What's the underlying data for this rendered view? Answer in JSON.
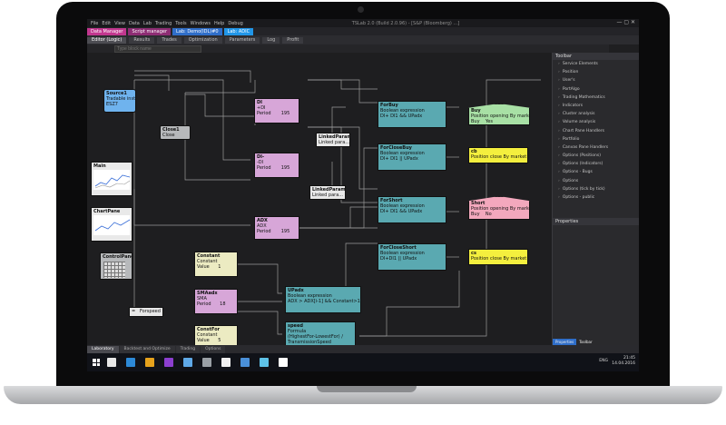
{
  "window": {
    "title": "TSLab 2.0 (Build 2.0.96) - [S&P (Bloomberg) ...]",
    "menu": [
      "File",
      "Edit",
      "View",
      "Data",
      "Lab",
      "Trading",
      "Tools",
      "Windows",
      "Help",
      "Debug"
    ]
  },
  "tabs": [
    "Data Manager",
    "Script manager",
    "Lab: Demo(IDL)#0",
    "Lab: ADIC"
  ],
  "toolbar": [
    "Editor (Logic)",
    "Results",
    "Trades",
    "Optimization",
    "Parameters",
    "Log",
    "Profit"
  ],
  "search": {
    "placeholder": "Type block name"
  },
  "nodes": {
    "source1": {
      "name": "Source1",
      "lines": [
        "Tradable instrument",
        "ESZ7"
      ]
    },
    "close1": {
      "name": "Close1",
      "lines": [
        "Close"
      ]
    },
    "di_plus": {
      "name": "DI",
      "lines": [
        "+DI",
        "Period",
        "195"
      ]
    },
    "di_minus": {
      "name": "DI-",
      "lines": [
        "-DI",
        "Period",
        "195"
      ]
    },
    "linked1": {
      "name": "LinkedParamet",
      "lines": [
        "Linked para..."
      ]
    },
    "linked2": {
      "name": "LinkedParamet1",
      "lines": [
        "Linked para..."
      ]
    },
    "forbuy": {
      "name": "ForBuy",
      "lines": [
        "Boolean expression",
        "DI+ DI1 && UPadx"
      ]
    },
    "forclosebuy": {
      "name": "ForCloseBuy",
      "lines": [
        "Boolean expression",
        "DI+ DI1 || UPadx"
      ]
    },
    "forshort": {
      "name": "ForShort",
      "lines": [
        "Boolean expression",
        "DI+ DI1 && UPadx"
      ]
    },
    "forcloseshort": {
      "name": "ForCloseShort",
      "lines": [
        "Boolean expression",
        "DI+DI1 || UPadx"
      ]
    },
    "buy": {
      "name": "Buy",
      "lines": [
        "Position opening By market",
        "Buy",
        "Yes"
      ]
    },
    "cb": {
      "name": "cb",
      "lines": [
        "Position close By market"
      ]
    },
    "short": {
      "name": "Short",
      "lines": [
        "Position opening By market",
        "Buy",
        "No"
      ]
    },
    "cs": {
      "name": "cs",
      "lines": [
        "Position close By market"
      ]
    },
    "main": {
      "name": "Main"
    },
    "chartpane": {
      "name": "ChartPane"
    },
    "controlpane": {
      "name": "ControlPane"
    },
    "adx": {
      "name": "ADX",
      "lines": [
        "ADX",
        "Period",
        "195"
      ]
    },
    "constant": {
      "name": "Constant",
      "lines": [
        "Constant",
        "Value",
        "1"
      ]
    },
    "smaadx": {
      "name": "SMAadx",
      "lines": [
        "SMA",
        "Period",
        "18"
      ]
    },
    "upadx": {
      "name": "UPadx",
      "lines": [
        "Boolean expression",
        "ADX > ADX[i-1] && Constant>1 ||..."
      ]
    },
    "forspeed": {
      "name": "Forspeed",
      "lines": [
        "="
      ]
    },
    "constfor": {
      "name": "ConstFor",
      "lines": [
        "Constant",
        "Value",
        "5"
      ]
    },
    "speed": {
      "name": "speed",
      "lines": [
        "Formula",
        "(HighestFor-LowestFor) /",
        "TransmissionSpeed"
      ]
    }
  },
  "right_panel": {
    "header": "Toolbar",
    "items": [
      "Service Elements",
      "Position",
      "User's",
      "PortAlgo",
      "Trading Mathematics",
      "Indicators",
      "Cluster analysis",
      "Volume analysis",
      "Chart Pane Handlers",
      "Portfolio",
      "Canvas Pane Handlers",
      "Options (Positions)",
      "Options (Indicators)",
      "Options - Bugs",
      "Options",
      "Options (tick by tick)",
      "Options - public"
    ],
    "properties_header": "Properties",
    "tabs": [
      "Properties",
      "Toolbar"
    ]
  },
  "bottom_tabs": [
    "Laboratory",
    "Backtest and Optimize",
    "Trading",
    "Options"
  ],
  "taskbar": {
    "time": "21:45",
    "date": "14.04.2016",
    "lang": "ENG",
    "icon_colors": [
      "#e8e8e8",
      "#2d8ad8",
      "#e6a21c",
      "#8c3fd0",
      "#5fa9e8",
      "#9aa0a6",
      "#f0f0f0",
      "#4a90d9",
      "#5ec2e8",
      "#ffffff"
    ]
  }
}
